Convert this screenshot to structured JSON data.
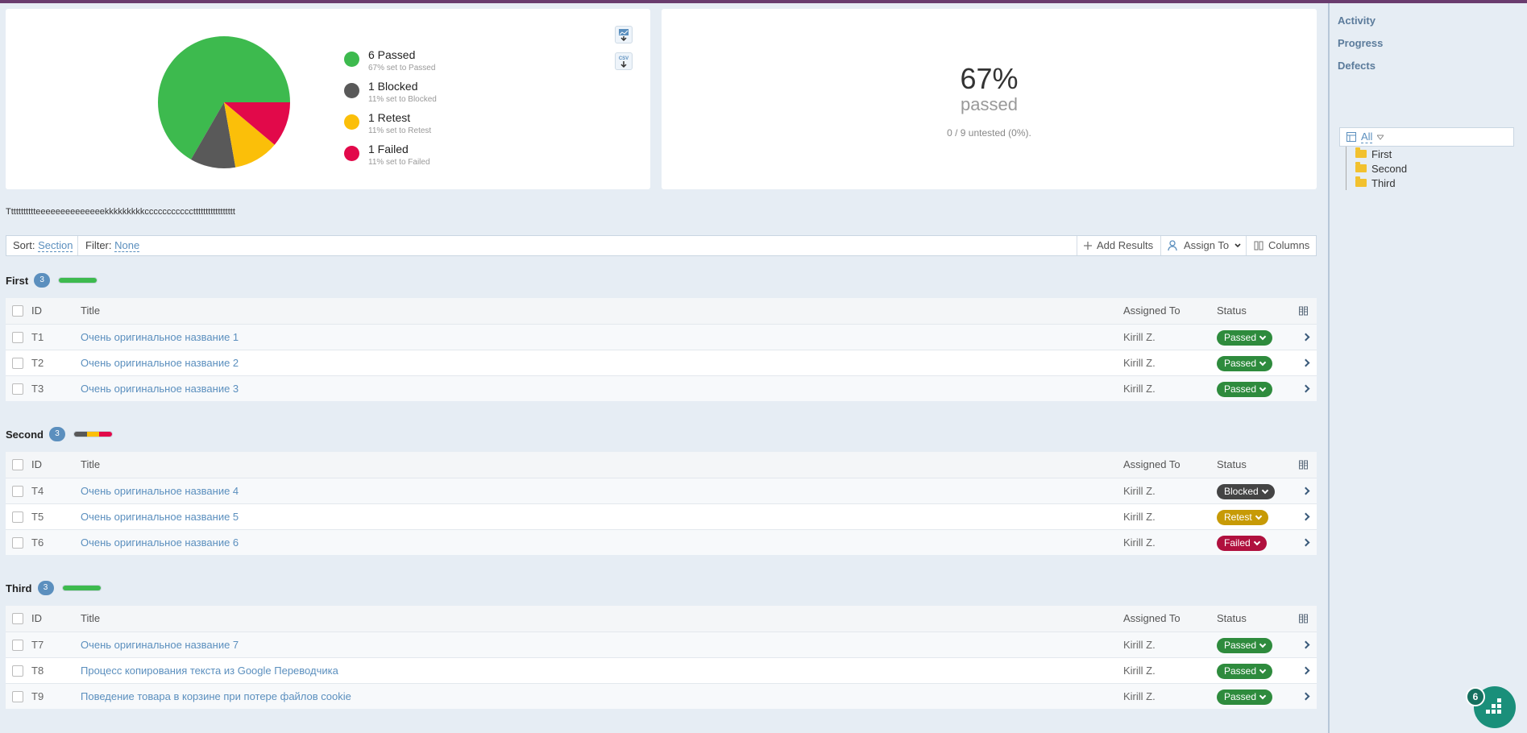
{
  "chart_data": {
    "type": "pie",
    "slices": [
      {
        "label": "Passed",
        "value": 6,
        "color": "#3dba4e"
      },
      {
        "label": "Blocked",
        "value": 1,
        "color": "#595959"
      },
      {
        "label": "Retest",
        "value": 1,
        "color": "#fbbf09"
      },
      {
        "label": "Failed",
        "value": 1,
        "color": "#e2094a"
      }
    ]
  },
  "legend": [
    {
      "title": "6 Passed",
      "sub": "67% set to Passed",
      "color": "#3dba4e"
    },
    {
      "title": "1 Blocked",
      "sub": "11% set to Blocked",
      "color": "#595959"
    },
    {
      "title": "1 Retest",
      "sub": "11% set to Retest",
      "color": "#fbbf09"
    },
    {
      "title": "1 Failed",
      "sub": "11% set to Failed",
      "color": "#e2094a"
    }
  ],
  "export": {
    "image_icon": "image-export-icon",
    "csv_icon": "csv-export-icon",
    "csv_label": "CSV"
  },
  "summary": {
    "percent": "67%",
    "label": "passed",
    "untested": "0 / 9 untested (0%)."
  },
  "description": "Ttttttttttteeeeeeeeeeeeeekkkkkkkkkcccccccccccttttttttttttttttt",
  "toolbar": {
    "sort_label": "Sort:",
    "sort_value": "Section",
    "filter_label": "Filter:",
    "filter_value": "None",
    "add_results": "Add Results",
    "assign_to": "Assign To",
    "columns": "Columns"
  },
  "columns": {
    "id": "ID",
    "title": "Title",
    "assigned": "Assigned To",
    "status": "Status"
  },
  "status_colors": {
    "Passed": "#2e8b3d",
    "Blocked": "#444444",
    "Retest": "#c79a06",
    "Failed": "#b0103e"
  },
  "sections": [
    {
      "name": "First",
      "count": "3",
      "bar": [
        {
          "color": "#3dba4e",
          "frac": 1
        }
      ],
      "rows": [
        {
          "id": "T1",
          "title": "Очень оригинальное название 1",
          "assigned": "Kirill Z.",
          "status": "Passed"
        },
        {
          "id": "T2",
          "title": "Очень оригинальное название 2",
          "assigned": "Kirill Z.",
          "status": "Passed"
        },
        {
          "id": "T3",
          "title": "Очень оригинальное название 3",
          "assigned": "Kirill Z.",
          "status": "Passed"
        }
      ]
    },
    {
      "name": "Second",
      "count": "3",
      "bar": [
        {
          "color": "#595959",
          "frac": 0.333
        },
        {
          "color": "#fbbf09",
          "frac": 0.334
        },
        {
          "color": "#e2094a",
          "frac": 0.333
        }
      ],
      "rows": [
        {
          "id": "T4",
          "title": "Очень оригинальное название 4",
          "assigned": "Kirill Z.",
          "status": "Blocked"
        },
        {
          "id": "T5",
          "title": "Очень оригинальное название 5",
          "assigned": "Kirill Z.",
          "status": "Retest"
        },
        {
          "id": "T6",
          "title": "Очень оригинальное название 6",
          "assigned": "Kirill Z.",
          "status": "Failed"
        }
      ]
    },
    {
      "name": "Third",
      "count": "3",
      "bar": [
        {
          "color": "#3dba4e",
          "frac": 1
        }
      ],
      "rows": [
        {
          "id": "T7",
          "title": "Очень оригинальное название 7",
          "assigned": "Kirill Z.",
          "status": "Passed"
        },
        {
          "id": "T8",
          "title": "Процесс копирования текста из Google Переводчика",
          "assigned": "Kirill Z.",
          "status": "Passed"
        },
        {
          "id": "T9",
          "title": "Поведение товара в корзине при потере файлов cookie",
          "assigned": "Kirill Z.",
          "status": "Passed"
        }
      ]
    }
  ],
  "sidebar": {
    "links": [
      "Activity",
      "Progress",
      "Defects"
    ],
    "tree_all": "All",
    "tree_items": [
      "First",
      "Second",
      "Third"
    ]
  },
  "fab": {
    "badge": "6",
    "icon": "grid-dots-icon"
  }
}
